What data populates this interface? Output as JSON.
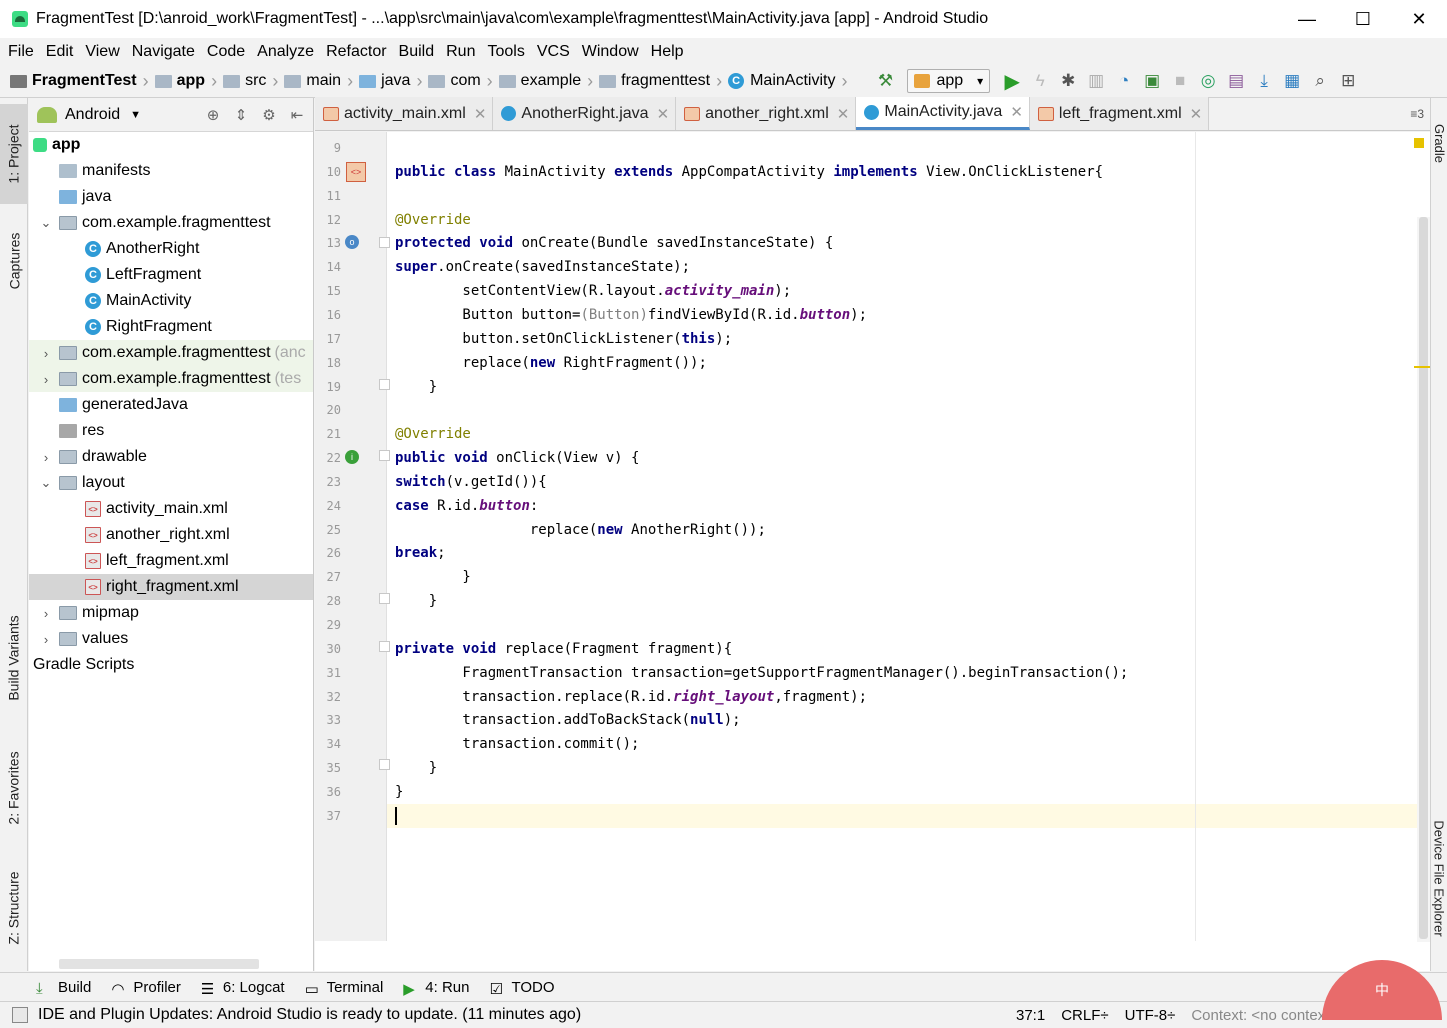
{
  "window": {
    "title": "FragmentTest [D:\\anroid_work\\FragmentTest] - ...\\app\\src\\main\\java\\com\\example\\fragmenttest\\MainActivity.java [app] - Android Studio",
    "minimize": "—",
    "maximize": "☐",
    "close": "✕"
  },
  "menu": [
    "File",
    "Edit",
    "View",
    "Navigate",
    "Code",
    "Analyze",
    "Refactor",
    "Build",
    "Run",
    "Tools",
    "VCS",
    "Window",
    "Help"
  ],
  "breadcrumb": [
    "FragmentTest",
    "app",
    "src",
    "main",
    "java",
    "com",
    "example",
    "fragmenttest",
    "MainActivity"
  ],
  "run_config": "app",
  "left_tools": [
    "1: Project",
    "Captures",
    "Build Variants",
    "2: Favorites",
    "Z: Structure"
  ],
  "right_tools": [
    "Gradle",
    "Device File Explorer"
  ],
  "project_panel": {
    "view": "Android",
    "tree": [
      {
        "label": "app",
        "level": 0,
        "icon": "app",
        "arrow": "",
        "bold": true
      },
      {
        "label": "manifests",
        "level": 1,
        "icon": "folder",
        "arrow": ""
      },
      {
        "label": "java",
        "level": 1,
        "icon": "folder-blue",
        "arrow": ""
      },
      {
        "label": "com.example.fragmenttest",
        "level": 1,
        "icon": "pkg",
        "arrow": "▾"
      },
      {
        "label": "AnotherRight",
        "level": 2,
        "icon": "cls",
        "arrow": ""
      },
      {
        "label": "LeftFragment",
        "level": 2,
        "icon": "cls",
        "arrow": ""
      },
      {
        "label": "MainActivity",
        "level": 2,
        "icon": "cls",
        "arrow": ""
      },
      {
        "label": "RightFragment",
        "level": 2,
        "icon": "cls",
        "arrow": ""
      },
      {
        "label": "com.example.fragmenttest",
        "suffix": "(anc",
        "level": 1,
        "icon": "pkg",
        "arrow": "›",
        "module": true
      },
      {
        "label": "com.example.fragmenttest",
        "suffix": "(tes",
        "level": 1,
        "icon": "pkg",
        "arrow": "›",
        "module": true
      },
      {
        "label": "generatedJava",
        "level": 1,
        "icon": "folder-blue",
        "arrow": ""
      },
      {
        "label": "res",
        "level": 1,
        "icon": "folder-res",
        "arrow": ""
      },
      {
        "label": "drawable",
        "level": 1,
        "icon": "pkg",
        "arrow": "›"
      },
      {
        "label": "layout",
        "level": 1,
        "icon": "pkg",
        "arrow": "▾"
      },
      {
        "label": "activity_main.xml",
        "level": 2,
        "icon": "xml",
        "arrow": ""
      },
      {
        "label": "another_right.xml",
        "level": 2,
        "icon": "xml",
        "arrow": ""
      },
      {
        "label": "left_fragment.xml",
        "level": 2,
        "icon": "xml",
        "arrow": ""
      },
      {
        "label": "right_fragment.xml",
        "level": 2,
        "icon": "xml",
        "arrow": "",
        "selected": true
      },
      {
        "label": "mipmap",
        "level": 1,
        "icon": "pkg",
        "arrow": "›"
      },
      {
        "label": "values",
        "level": 1,
        "icon": "pkg",
        "arrow": "›"
      },
      {
        "label": "Gradle Scripts",
        "level": 0,
        "icon": "gradle",
        "arrow": ""
      }
    ]
  },
  "tabs": [
    {
      "label": "activity_main.xml",
      "icon": "xml"
    },
    {
      "label": "AnotherRight.java",
      "icon": "cls"
    },
    {
      "label": "another_right.xml",
      "icon": "xml"
    },
    {
      "label": "MainActivity.java",
      "icon": "cls",
      "active": true
    },
    {
      "label": "left_fragment.xml",
      "icon": "xml"
    }
  ],
  "tab_overflow": "≡3",
  "code_lines": [
    {
      "n": "9",
      "html": ""
    },
    {
      "n": "10",
      "html": "<span class='kw'>public class</span> MainActivity <span class='kw'>extends</span> AppCompatActivity <span class='kw'>implements</span> View.OnClickListener{"
    },
    {
      "n": "11",
      "html": ""
    },
    {
      "n": "12",
      "html": "    <span class='ann'>@Override</span>"
    },
    {
      "n": "13",
      "html": "    <span class='kw'>protected void</span> onCreate(Bundle savedInstanceState) {"
    },
    {
      "n": "14",
      "html": "        <span class='kw'>super</span>.onCreate(savedInstanceState);"
    },
    {
      "n": "15",
      "html": "        setContentView(R.layout.<span class='fld'>activity_main</span>);"
    },
    {
      "n": "16",
      "html": "        Button button=<span class='cast'>(Button)</span>findViewById(R.id.<span class='fld'>button</span>);"
    },
    {
      "n": "17",
      "html": "        button.setOnClickListener(<span class='kw'>this</span>);"
    },
    {
      "n": "18",
      "html": "        replace(<span class='kw'>new</span> RightFragment());"
    },
    {
      "n": "19",
      "html": "    }"
    },
    {
      "n": "20",
      "html": ""
    },
    {
      "n": "21",
      "html": "    <span class='ann'>@Override</span>"
    },
    {
      "n": "22",
      "html": "    <span class='kw'>public void</span> onClick(View v) {"
    },
    {
      "n": "23",
      "html": "        <span class='kw'>switch</span>(v.getId()){"
    },
    {
      "n": "24",
      "html": "            <span class='kw'>case</span> R.id.<span class='fld'>button</span>:"
    },
    {
      "n": "25",
      "html": "                replace(<span class='kw'>new</span> AnotherRight());"
    },
    {
      "n": "26",
      "html": "                <span class='kw'>break</span>;"
    },
    {
      "n": "27",
      "html": "        }"
    },
    {
      "n": "28",
      "html": "    }"
    },
    {
      "n": "29",
      "html": ""
    },
    {
      "n": "30",
      "html": "    <span class='kw'>private void</span> replace(Fragment fragment){"
    },
    {
      "n": "31",
      "html": "        FragmentTransaction transaction=getSupportFragmentManager().beginTransaction();"
    },
    {
      "n": "32",
      "html": "        transaction.replace(R.id.<span class='fld'>right_layout</span>,fragment);"
    },
    {
      "n": "33",
      "html": "        transaction.addToBackStack(<span class='kw'>null</span>);"
    },
    {
      "n": "34",
      "html": "        transaction.commit();"
    },
    {
      "n": "35",
      "html": "    }"
    },
    {
      "n": "36",
      "html": "}"
    },
    {
      "n": "37",
      "html": "",
      "current": true
    }
  ],
  "bottom_tools": [
    {
      "label": "Build",
      "icon": "build-icon"
    },
    {
      "label": "Profiler",
      "icon": "profiler-icon"
    },
    {
      "label": "6: Logcat",
      "icon": "logcat-icon"
    },
    {
      "label": "Terminal",
      "icon": "terminal-icon"
    },
    {
      "label": "4: Run",
      "icon": "run-icon"
    },
    {
      "label": "TODO",
      "icon": "todo-icon"
    }
  ],
  "status": {
    "message": "IDE and Plugin Updates: Android Studio is ready to update. (11 minutes ago)",
    "position": "37:1",
    "line_sep": "CRLF÷",
    "encoding": "UTF-8÷",
    "context": "Context: <no context>"
  },
  "ime_label": "中"
}
